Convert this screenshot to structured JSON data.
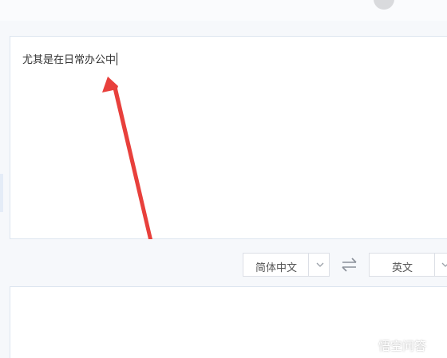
{
  "source": {
    "text": "尤其是在日常办公中"
  },
  "language_bar": {
    "source_language": "简体中文",
    "target_language": "英文"
  },
  "watermark": {
    "text": "悟空问答"
  },
  "colors": {
    "accent_arrow": "#e8403c",
    "panel_border": "#dde5ef",
    "page_background": "#f6f8fb"
  },
  "icons": {
    "swap": "swap-arrows-icon",
    "dropdown": "chevron-down-icon",
    "annotation": "red-arrow-annotation"
  }
}
